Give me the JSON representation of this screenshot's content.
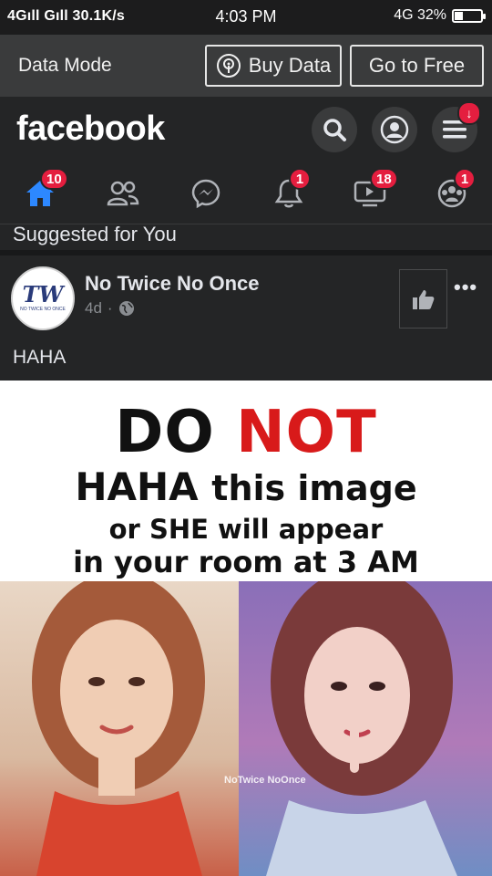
{
  "status_bar": {
    "left": "4Gıll Gıll 30.1K/s",
    "time": "4:03 PM",
    "right": "4G 32%",
    "battery_level": 0.32
  },
  "data_mode": {
    "label": "Data Mode",
    "buy_label": "Buy Data",
    "free_label": "Go to Free"
  },
  "header": {
    "logo": "facebook",
    "menu_badge": "↓"
  },
  "nav": {
    "home_badge": "10",
    "notifications_badge": "1",
    "watch_badge": "18",
    "groups_badge": "1"
  },
  "feed": {
    "suggested_label": "Suggested for You"
  },
  "post": {
    "author": "No Twice No Once",
    "time": "4d",
    "separator": "·",
    "text": "HAHA",
    "more": "•••",
    "avatar_mark": "TW",
    "avatar_caption": "NO TWICE NO ONCE",
    "image": {
      "line1_a": "DO",
      "line1_b": "NOT",
      "line2_a": "HAHA",
      "line2_b": "this image",
      "line3": "or SHE will appear",
      "line4": "in your room at 3 AM",
      "watermark": "NoTwice NoOnce"
    }
  },
  "colors": {
    "accent": "#1877f2",
    "badge": "#e41e3f",
    "background": "#242526"
  }
}
